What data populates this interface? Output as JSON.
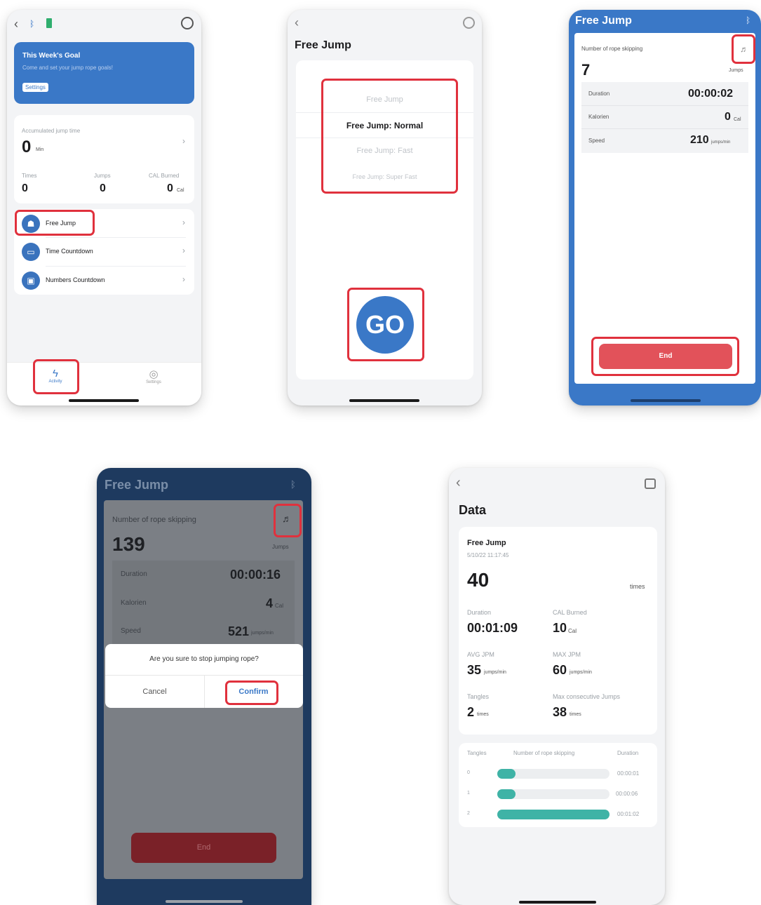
{
  "p1": {
    "goal_title": "This Week's Goal",
    "goal_sub": "Come and set your jump rope goals!",
    "goal_btn": "Settings",
    "acc_label": "Accumulated jump time",
    "acc_value": "0",
    "acc_unit": "Min",
    "stats": [
      {
        "label": "Times",
        "value": "0",
        "unit": ""
      },
      {
        "label": "Jumps",
        "value": "0",
        "unit": ""
      },
      {
        "label": "CAL Burned",
        "value": "0",
        "unit": "Cal"
      }
    ],
    "modes": [
      "Free Jump",
      "Time Countdown",
      "Numbers Countdown"
    ],
    "tabs": [
      "Activity",
      "Settings"
    ]
  },
  "p2": {
    "title": "Free Jump",
    "options": [
      "Free Jump",
      "Free Jump: Normal",
      "Free Jump: Fast",
      "Free Jump: Super Fast"
    ],
    "go_label": "GO"
  },
  "p3": {
    "title": "Free Jump",
    "count_label": "Number of rope skipping",
    "count_value": "7",
    "count_unit": "Jumps",
    "rows": [
      {
        "label": "Duration",
        "value": "00:00:02",
        "unit": ""
      },
      {
        "label": "Kalorien",
        "value": "0",
        "unit": "Cal"
      },
      {
        "label": "Speed",
        "value": "210",
        "unit": "jumps/min"
      }
    ],
    "end_label": "End"
  },
  "p4": {
    "title": "Free Jump",
    "count_label": "Number of rope skipping",
    "count_value": "139",
    "count_unit": "Jumps",
    "rows": [
      {
        "label": "Duration",
        "value": "00:00:16",
        "unit": ""
      },
      {
        "label": "Kalorien",
        "value": "4",
        "unit": "Cal"
      },
      {
        "label": "Speed",
        "value": "521",
        "unit": "jumps/min"
      }
    ],
    "dialog_text": "Are you sure to stop jumping rope?",
    "cancel_label": "Cancel",
    "confirm_label": "Confirm",
    "end_label": "End"
  },
  "p5": {
    "title": "Data",
    "session_title": "Free Jump",
    "session_date": "5/10/22 11:17:45",
    "total": "40",
    "total_unit": "times",
    "metrics": [
      {
        "label": "Duration",
        "value": "00:01:09",
        "unit": ""
      },
      {
        "label": "CAL Burned",
        "value": "10",
        "unit": "Cal"
      },
      {
        "label": "AVG JPM",
        "value": "35",
        "unit": "jumps/min"
      },
      {
        "label": "MAX JPM",
        "value": "60",
        "unit": "jumps/min"
      },
      {
        "label": "Tangles",
        "value": "2",
        "unit": "times"
      },
      {
        "label": "Max consecutive Jumps",
        "value": "38",
        "unit": "times"
      }
    ],
    "table_headers": [
      "Tangles",
      "Number of rope skipping",
      "Duration"
    ],
    "table_rows": [
      {
        "index": "0",
        "fill": 0.16,
        "duration": "00:00:01"
      },
      {
        "index": "1",
        "fill": 0.16,
        "duration": "00:00:06"
      },
      {
        "index": "2",
        "fill": 1.0,
        "duration": "00:01:02"
      }
    ]
  }
}
